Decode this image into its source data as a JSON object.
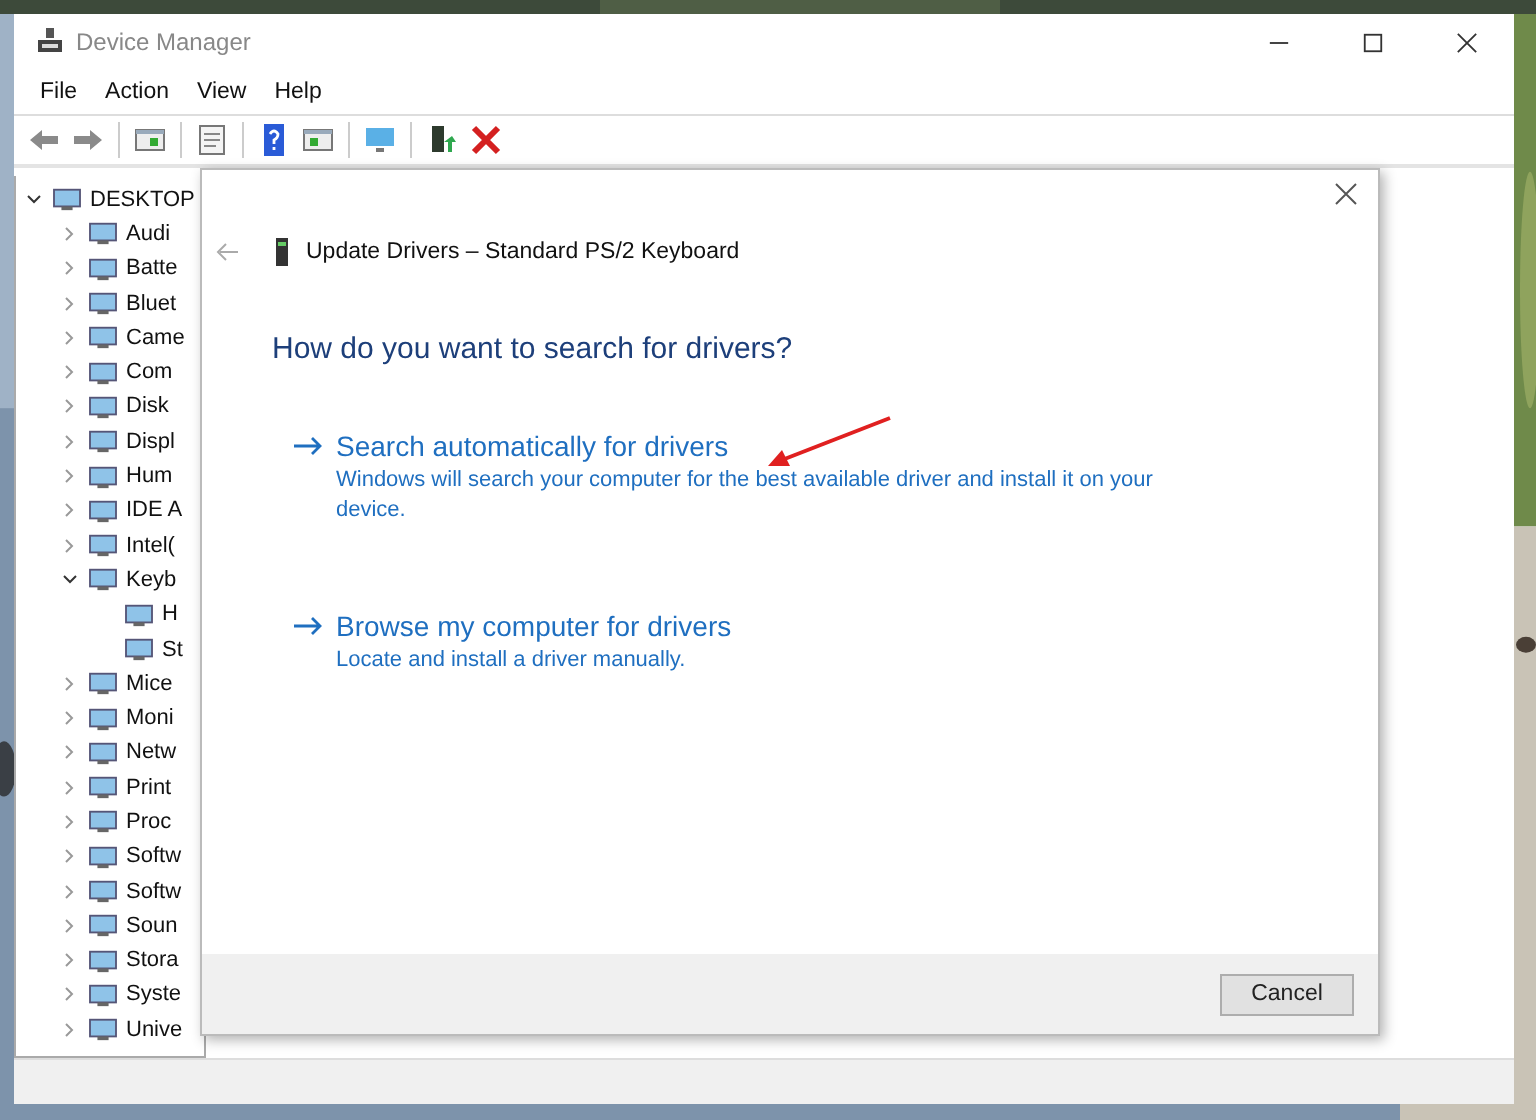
{
  "window": {
    "title": "Device Manager"
  },
  "menu": [
    "File",
    "Action",
    "View",
    "Help"
  ],
  "tree": {
    "label": "DESKTOP",
    "expanded": true,
    "children": [
      {
        "label": "Audi",
        "expanded": false
      },
      {
        "label": "Batte",
        "expanded": false
      },
      {
        "label": "Bluet",
        "expanded": false
      },
      {
        "label": "Came",
        "expanded": false
      },
      {
        "label": "Com",
        "expanded": false
      },
      {
        "label": "Disk",
        "expanded": false
      },
      {
        "label": "Displ",
        "expanded": false
      },
      {
        "label": "Hum",
        "expanded": false
      },
      {
        "label": "IDE A",
        "expanded": false
      },
      {
        "label": "Intel(",
        "expanded": false
      },
      {
        "label": "Keyb",
        "expanded": true,
        "children": [
          {
            "label": "H"
          },
          {
            "label": "St"
          }
        ]
      },
      {
        "label": "Mice",
        "expanded": false
      },
      {
        "label": "Moni",
        "expanded": false
      },
      {
        "label": "Netw",
        "expanded": false
      },
      {
        "label": "Print",
        "expanded": false
      },
      {
        "label": "Proc",
        "expanded": false
      },
      {
        "label": "Softw",
        "expanded": false
      },
      {
        "label": "Softw",
        "expanded": false
      },
      {
        "label": "Soun",
        "expanded": false
      },
      {
        "label": "Stora",
        "expanded": false
      },
      {
        "label": "Syste",
        "expanded": false
      },
      {
        "label": "Unive",
        "expanded": false
      }
    ]
  },
  "dialog": {
    "title": "Update Drivers – Standard PS/2 Keyboard",
    "heading": "How do you want to search for drivers?",
    "options": [
      {
        "title": "Search automatically for drivers",
        "description": "Windows will search your computer for the best available driver and install it on your device."
      },
      {
        "title": "Browse my computer for drivers",
        "description": "Locate and install a driver manually."
      }
    ],
    "buttons": [
      "Cancel"
    ]
  }
}
